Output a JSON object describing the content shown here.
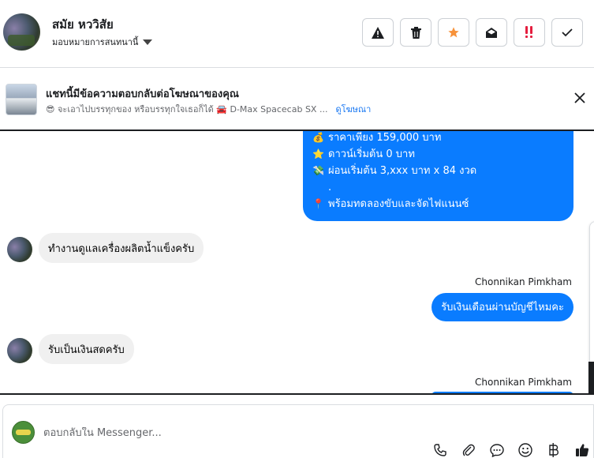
{
  "header": {
    "contact_name": "สมัย หววิสัย",
    "assign_label": "มอบหมายการสนทนานี้",
    "actions": [
      {
        "name": "report-spam-button",
        "icon": "warning-icon"
      },
      {
        "name": "delete-button",
        "icon": "trash-icon"
      },
      {
        "name": "star-button",
        "icon": "star-icon",
        "color": "#f7923a"
      },
      {
        "name": "mark-unread-button",
        "icon": "envelope-open-icon"
      },
      {
        "name": "follow-up-button",
        "icon": "exclamation-icon",
        "color": "#e41e3f"
      },
      {
        "name": "mark-done-button",
        "icon": "checkmark-icon"
      }
    ]
  },
  "ad_banner": {
    "title": "แชทนี้มีข้อความตอบกลับต่อโฆษณาของคุณ",
    "description": "😎 จะเอาไปบรรทุกของ หรือบรรทุกใจเธอก็ได้ 🚘 D-Max Spacecab SX ...",
    "link_label": "ดูโฆษณา"
  },
  "messages": {
    "promo_lines": [
      {
        "icon": "💰",
        "text": "ราคาเพียง 159,000 บาท"
      },
      {
        "icon": "⭐",
        "text": "ดาวน์เริ่มต้น 0 บาท"
      },
      {
        "icon": "💸",
        "text": "ผ่อนเริ่มต้น 3,xxx บาท x 84 งวด"
      },
      {
        "icon": "",
        "text": "."
      },
      {
        "icon": "📍",
        "text": "พร้อมทดลองขับและจัดไฟแนนซ์"
      }
    ],
    "incoming_1": "ทำงานดูแลเครื่องผลิตน้ำแข็งครับ",
    "sender_1": "Chonnikan Pimkham",
    "outgoing_1": "รับเงินเดือนผ่านบัญชีไหมคะ",
    "incoming_2": "รับเป็นเงินสดครับ",
    "sender_2": "Chonnikan Pimkham"
  },
  "reply": {
    "placeholder": "ตอบกลับใน Messenger...",
    "tools": [
      "phone-icon",
      "paperclip-icon",
      "saved-reply-icon",
      "emoji-icon",
      "baht-icon",
      "thumbs-up-icon"
    ]
  },
  "colors": {
    "accent": "#0a7cff",
    "incoming_bubble": "#f0f0f0",
    "link": "#1877f2"
  }
}
